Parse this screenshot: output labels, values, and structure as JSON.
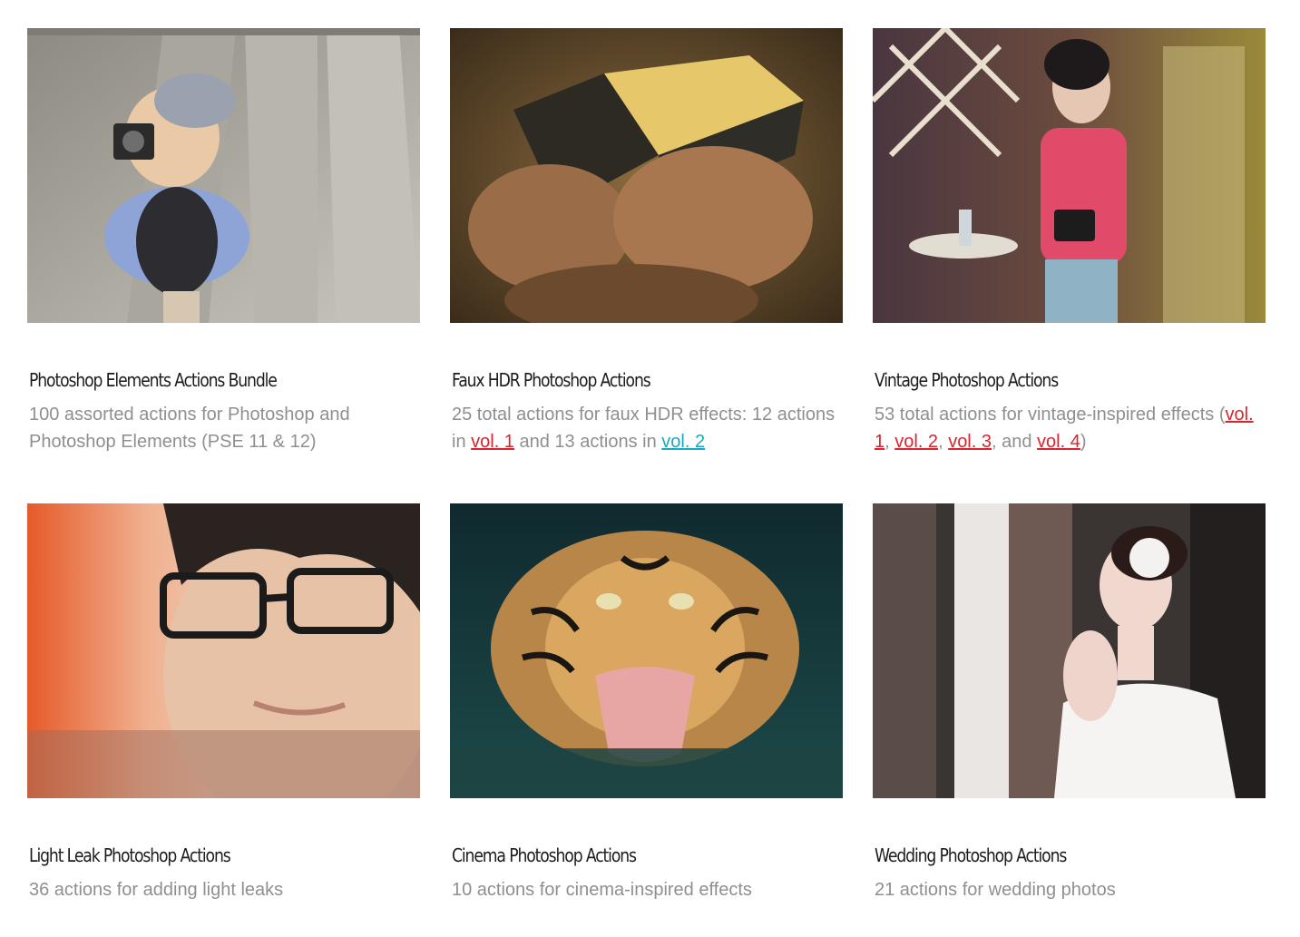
{
  "products": [
    {
      "title": "Photoshop Elements Actions Bundle",
      "image_alt": "photographer with camera on stairs",
      "desc": "100 assorted actions for Photoshop and Photoshop Elements (PSE 11 & 12)"
    },
    {
      "title": "Faux HDR Photoshop Actions",
      "image_alt": "hands holding an old book",
      "desc_parts": {
        "before": "25 total actions for faux HDR effects: 12 actions in ",
        "link1": "vol. 1",
        "middle": " and 13 actions in ",
        "link2": "vol. 2"
      }
    },
    {
      "title": "Vintage Photoshop Actions",
      "image_alt": "woman holding a camera in a garden",
      "desc_parts": {
        "before": "53 total actions for vintage-inspired effects (",
        "link1": "vol. 1",
        "sep1": ", ",
        "link2": "vol. 2",
        "sep2": ", ",
        "link3": "vol. 3",
        "sep3": ", and ",
        "link4": "vol. 4",
        "after": ")"
      }
    },
    {
      "title": "Light Leak Photoshop Actions",
      "image_alt": "young man with glasses",
      "desc": "36 actions for adding light leaks"
    },
    {
      "title": "Cinema Photoshop Actions",
      "image_alt": "roaring tiger in water",
      "desc": "10 actions for cinema-inspired effects"
    },
    {
      "title": "Wedding Photoshop Actions",
      "image_alt": "bride by a window",
      "desc": "21 actions for wedding photos"
    }
  ],
  "colors": {
    "link_red": "#d8262e",
    "link_teal": "#1aa9bd",
    "title_text": "#1c1c1c",
    "desc_text": "#8f8f8f"
  }
}
